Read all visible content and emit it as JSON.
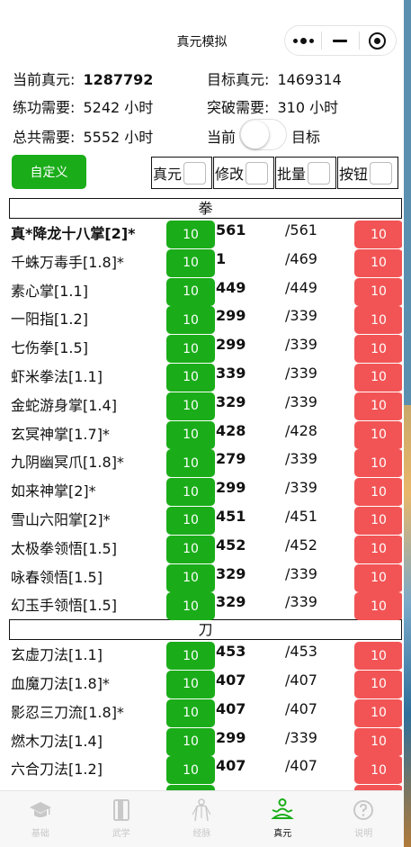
{
  "navbar": {
    "title": "真元模拟"
  },
  "info": {
    "current_label": "当前真元:",
    "current_value": "1287792",
    "target_label": "目标真元:",
    "target_value": "1469314",
    "train_label": "练功需要:",
    "train_value": "5242 小时",
    "break_label": "突破需要:",
    "break_value": "310 小时",
    "total_label": "总共需要:",
    "total_value": "5552 小时",
    "toggle_left": "当前",
    "toggle_right": "目标"
  },
  "controls": {
    "custom_button": "自定义",
    "options": [
      "真元",
      "修改",
      "批量",
      "按钮"
    ]
  },
  "sections": [
    {
      "title": "拳",
      "rows": [
        {
          "name": "真*降龙十八掌[2]*",
          "bold": true,
          "add": "10",
          "cur": "561",
          "max": "/561",
          "sub": "10"
        },
        {
          "name": "千蛛万毒手[1.8]*",
          "add": "10",
          "cur": "1",
          "max": "/469",
          "sub": "10"
        },
        {
          "name": "素心掌[1.1]",
          "add": "10",
          "cur": "449",
          "max": "/449",
          "sub": "10"
        },
        {
          "name": "一阳指[1.2]",
          "add": "10",
          "cur": "299",
          "max": "/339",
          "sub": "10"
        },
        {
          "name": "七伤拳[1.5]",
          "add": "10",
          "cur": "299",
          "max": "/339",
          "sub": "10"
        },
        {
          "name": "虾米拳法[1.1]",
          "add": "10",
          "cur": "339",
          "max": "/339",
          "sub": "10"
        },
        {
          "name": "金蛇游身掌[1.4]",
          "add": "10",
          "cur": "329",
          "max": "/339",
          "sub": "10"
        },
        {
          "name": "玄冥神掌[1.7]*",
          "add": "10",
          "cur": "428",
          "max": "/428",
          "sub": "10"
        },
        {
          "name": "九阴幽冥爪[1.8]*",
          "add": "10",
          "cur": "279",
          "max": "/339",
          "sub": "10"
        },
        {
          "name": "如来神掌[2]*",
          "add": "10",
          "cur": "299",
          "max": "/339",
          "sub": "10"
        },
        {
          "name": "雪山六阳掌[2]*",
          "add": "10",
          "cur": "451",
          "max": "/451",
          "sub": "10"
        },
        {
          "name": "太极拳领悟[1.5]",
          "add": "10",
          "cur": "452",
          "max": "/452",
          "sub": "10"
        },
        {
          "name": "咏春领悟[1.5]",
          "add": "10",
          "cur": "329",
          "max": "/339",
          "sub": "10"
        },
        {
          "name": "幻玉手领悟[1.5]",
          "add": "10",
          "cur": "329",
          "max": "/339",
          "sub": "10"
        }
      ]
    },
    {
      "title": "刀",
      "rows": [
        {
          "name": "玄虚刀法[1.1]",
          "add": "10",
          "cur": "453",
          "max": "/453",
          "sub": "10"
        },
        {
          "name": "血魔刀法[1.8]*",
          "add": "10",
          "cur": "407",
          "max": "/407",
          "sub": "10"
        },
        {
          "name": "影忍三刀流[1.8]*",
          "add": "10",
          "cur": "407",
          "max": "/407",
          "sub": "10"
        },
        {
          "name": "燃木刀法[1.4]",
          "add": "10",
          "cur": "299",
          "max": "/339",
          "sub": "10"
        },
        {
          "name": "六合刀法[1.2]",
          "add": "10",
          "cur": "407",
          "max": "/407",
          "sub": "10"
        },
        {
          "name": "",
          "add": "10",
          "cur": "",
          "max": "",
          "sub": "10"
        }
      ]
    }
  ],
  "tabbar": {
    "items": [
      {
        "label": "基础",
        "icon": "graduation-cap-icon"
      },
      {
        "label": "武学",
        "icon": "book-icon"
      },
      {
        "label": "经脉",
        "icon": "body-meridian-icon"
      },
      {
        "label": "真元",
        "icon": "meditation-icon"
      },
      {
        "label": "说明",
        "icon": "question-icon"
      }
    ],
    "active_index": 3
  },
  "colors": {
    "green": "#1aad19",
    "red": "#f25455",
    "active_tab": "#1aad19"
  }
}
